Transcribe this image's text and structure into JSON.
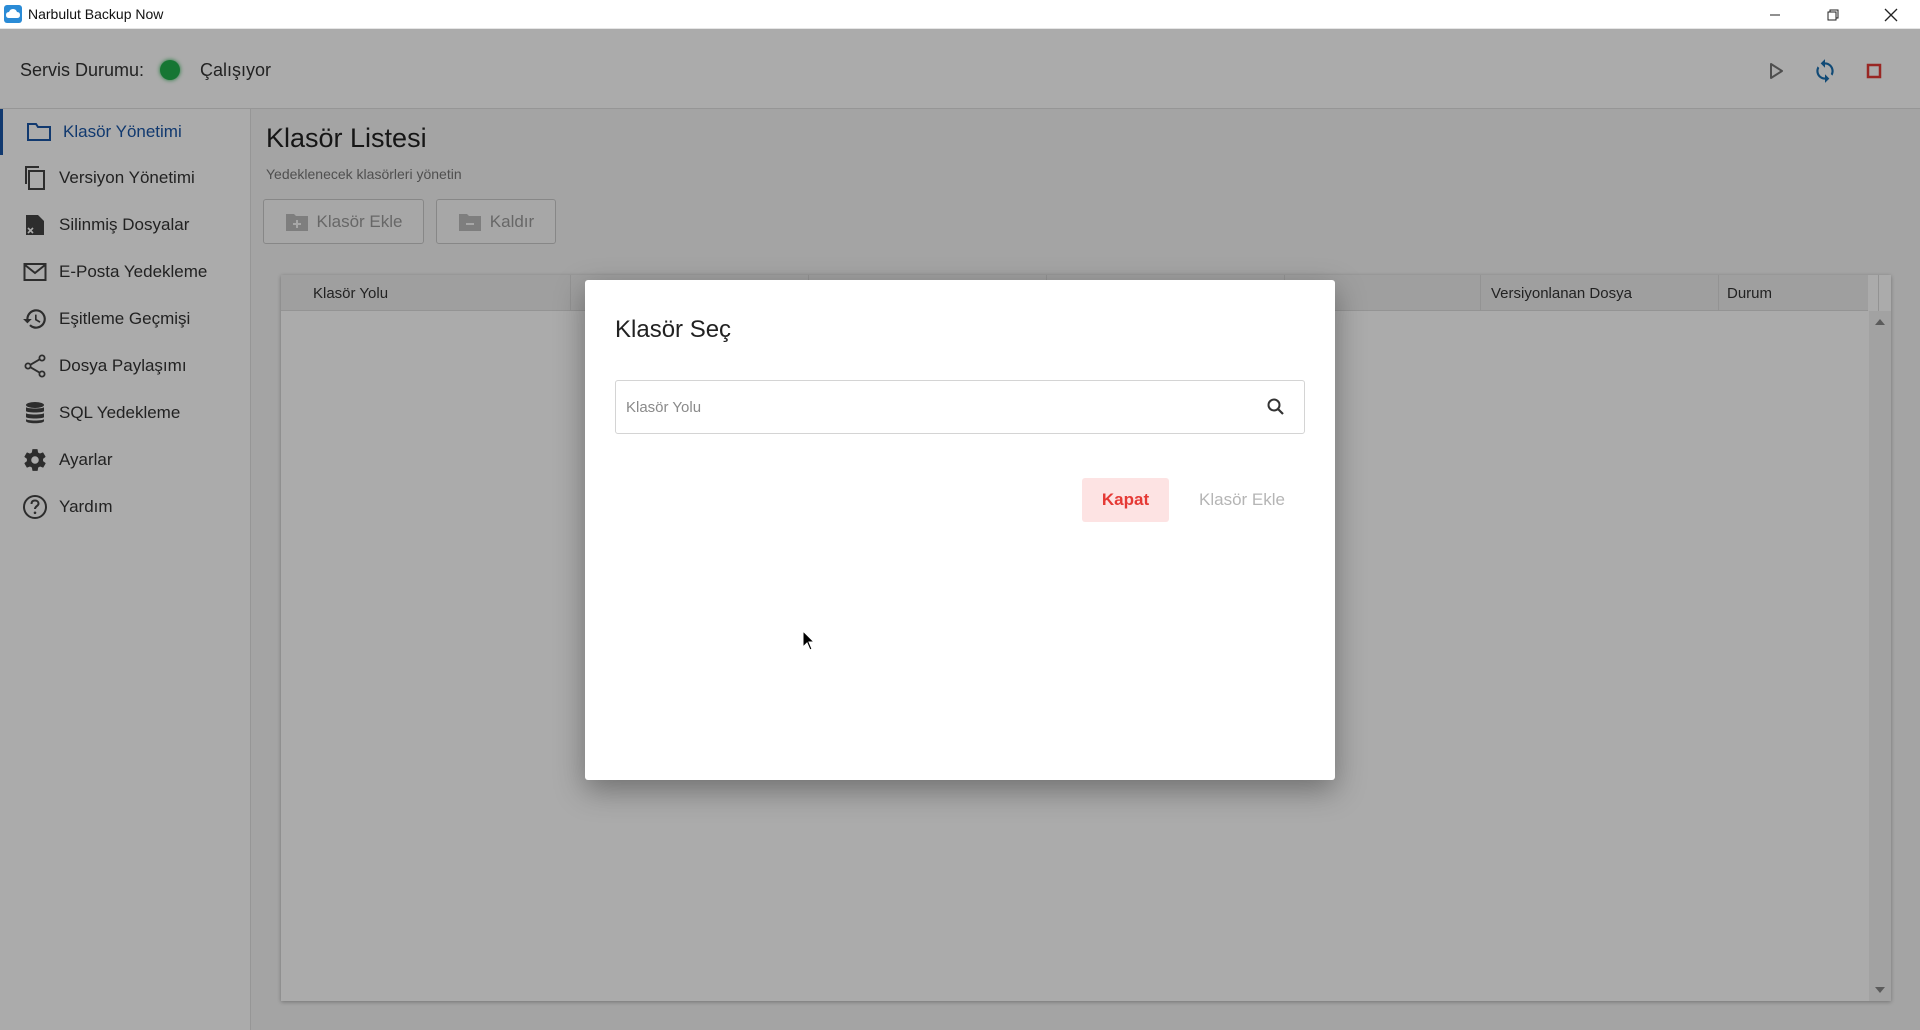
{
  "window": {
    "title": "Narbulut Backup Now",
    "controls": [
      "minimize",
      "restore",
      "close"
    ]
  },
  "status": {
    "label": "Servis Durumu:",
    "state": "Çalışıyor",
    "indicator_color": "#22b14c",
    "actions": [
      "play-icon",
      "sync-icon",
      "stop-icon"
    ]
  },
  "sidebar": {
    "items": [
      {
        "label": "Klasör Yönetimi",
        "icon": "folder-icon",
        "active": true
      },
      {
        "label": "Versiyon Yönetimi",
        "icon": "copy-icon",
        "active": false
      },
      {
        "label": "Silinmiş Dosyalar",
        "icon": "deleted-file-icon",
        "active": false
      },
      {
        "label": "E-Posta Yedekleme",
        "icon": "mail-icon",
        "active": false
      },
      {
        "label": "Eşitleme Geçmişi",
        "icon": "history-icon",
        "active": false
      },
      {
        "label": "Dosya Paylaşımı",
        "icon": "share-icon",
        "active": false
      },
      {
        "label": "SQL Yedekleme",
        "icon": "database-icon",
        "active": false
      },
      {
        "label": "Ayarlar",
        "icon": "gear-icon",
        "active": false
      },
      {
        "label": "Yardım",
        "icon": "help-icon",
        "active": false
      }
    ]
  },
  "main": {
    "title": "Klasör Listesi",
    "subtitle": "Yedeklenecek klasörleri yönetin",
    "toolbar": {
      "add_label": "Klasör Ekle",
      "remove_label": "Kaldır"
    },
    "table": {
      "columns": [
        "Klasör Yolu",
        "Versiyonlanan Dosya",
        "Durum"
      ],
      "rows": []
    }
  },
  "dialog": {
    "title": "Klasör Seç",
    "search": {
      "placeholder": "Klasör Yolu",
      "value": ""
    },
    "close_label": "Kapat",
    "add_label": "Klasör Ekle"
  },
  "colors": {
    "accent": "#1a56a6",
    "danger": "#e53935",
    "status_ok": "#22b14c"
  }
}
